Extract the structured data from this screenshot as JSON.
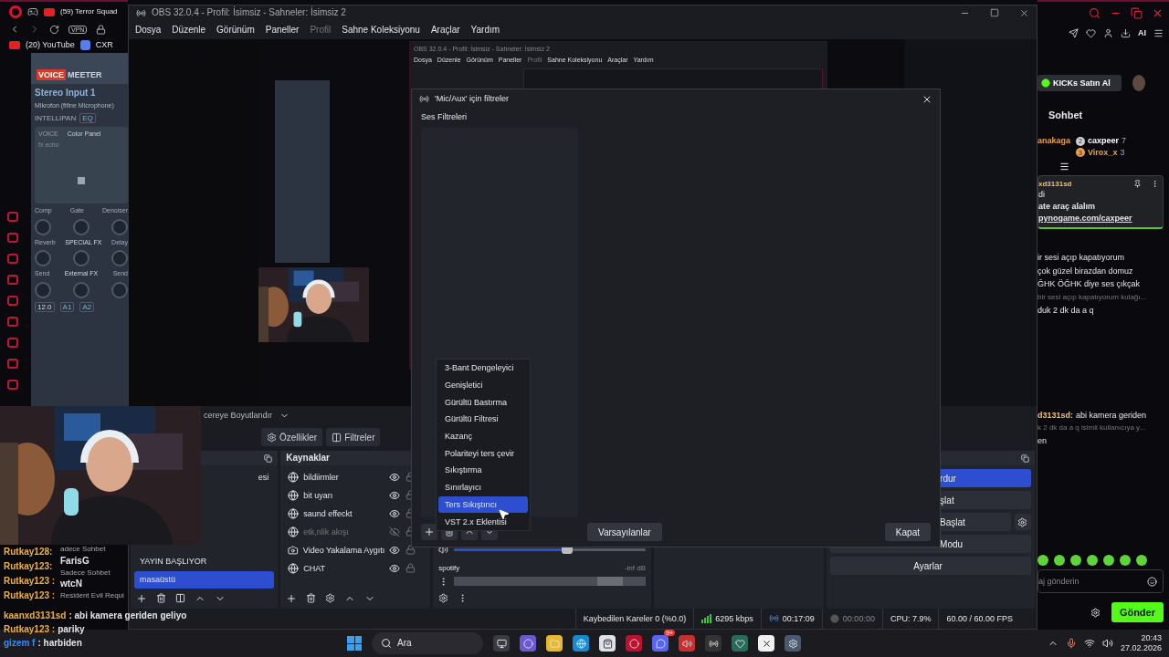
{
  "browser": {
    "tab": "(59) Terror Squad",
    "vpn": "VPN",
    "bookmarks": [
      "(20) YouTube",
      "CXR"
    ],
    "ai_button": "AI"
  },
  "voicemeeter": {
    "brand": [
      "VOICE",
      "MEETER"
    ],
    "strip_title": "Stereo Input 1",
    "strip_device": "Mikrofon (fifine Microphone)",
    "intellipan": "INTELLIPAN",
    "eq": "EQ",
    "voice": "VOICE",
    "color_panel": "Color Panel",
    "fx": "fx echo",
    "knob_rows": [
      [
        "Comp",
        "Gate",
        "Denoiser"
      ],
      [
        "Reverb",
        "SPECIAL FX",
        "Delay"
      ],
      [
        "Send",
        "External FX",
        "Send"
      ]
    ],
    "gain": "12.0",
    "buses": [
      "A1",
      "A2"
    ]
  },
  "obs": {
    "title": "OBS 32.0.4 - Profil: İsimsiz - Sahneler: İsimsiz 2",
    "menu": [
      {
        "label": "Dosya",
        "disabled": false
      },
      {
        "label": "Düzenle",
        "disabled": false
      },
      {
        "label": "Görünüm",
        "disabled": false
      },
      {
        "label": "Paneller",
        "disabled": false
      },
      {
        "label": "Profil",
        "disabled": true
      },
      {
        "label": "Sahne Koleksiyonu",
        "disabled": false
      },
      {
        "label": "Araçlar",
        "disabled": false
      },
      {
        "label": "Yardım",
        "disabled": false
      }
    ],
    "preview": {
      "title": "OBS 32.0.4 - Profil: İsimsiz - Sahneler: İsimsiz 2",
      "menu": [
        {
          "label": "Dosya",
          "disabled": false
        },
        {
          "label": "Düzenle",
          "disabled": false
        },
        {
          "label": "Görünüm",
          "disabled": false
        },
        {
          "label": "Paneller",
          "disabled": false
        },
        {
          "label": "Profil",
          "disabled": true
        },
        {
          "label": "Sahne Koleksiyonu",
          "disabled": false
        },
        {
          "label": "Araçlar",
          "disabled": false
        },
        {
          "label": "Yardım",
          "disabled": false
        }
      ]
    },
    "resize_dropdown": "cereye Boyutlandır",
    "toolbar": [
      {
        "kind": "gear",
        "label": "Özellikler"
      },
      {
        "kind": "filter",
        "label": "Filtreler"
      }
    ],
    "scenes": [
      {
        "label": "esi",
        "selected": false
      },
      {
        "label": "YAYIN BAŞLIYOR",
        "selected": false
      },
      {
        "label": "masaüstü",
        "selected": true
      }
    ],
    "sources": {
      "title": "Kaynaklar",
      "items": [
        {
          "kind": "browser",
          "label": "bildiirmler",
          "visible": true
        },
        {
          "kind": "browser",
          "label": "bit uyarı",
          "visible": true
        },
        {
          "kind": "browser",
          "label": "saund effeckt",
          "visible": true
        },
        {
          "kind": "browser",
          "label": "etk,nlik akışı",
          "visible": false
        },
        {
          "kind": "camera",
          "label": "Video Yakalama Aygıtı",
          "visible": true
        },
        {
          "kind": "browser",
          "label": "CHAT",
          "visible": true
        }
      ]
    },
    "mixer": {
      "level": 0.59,
      "channel": "spotify",
      "reading": "-inf dB"
    },
    "controls": [
      {
        "label": "rdur",
        "active": true
      },
      {
        "label": "şlat",
        "active": false
      },
      {
        "label": "Başlat",
        "active": false
      },
      {
        "label": "Modu",
        "active": false
      },
      {
        "label": "Ayarlar",
        "active": false
      }
    ],
    "status": {
      "dropped": "Kaybedilen Kareler 0 (%0.0)",
      "bitrate": "6295 kbps",
      "stream_time": "00:17:09",
      "record_time": "00:00:00",
      "cpu": "CPU: 7.9%",
      "fps": "60.00 / 60.00 FPS"
    }
  },
  "filters_dialog": {
    "title": "'Mic/Aux' için filtreler",
    "section": "Ses Filtreleri",
    "defaults_button": "Varsayılanlar",
    "close_button": "Kapat"
  },
  "filter_menu": [
    {
      "label": "3-Bant Dengeleyici",
      "selected": false
    },
    {
      "label": "Genişletici",
      "selected": false
    },
    {
      "label": "Gürültü Bastırma",
      "selected": false
    },
    {
      "label": "Gürültü Filtresi",
      "selected": false
    },
    {
      "label": "Kazanç",
      "selected": false
    },
    {
      "label": "Polariteyi ters çevir",
      "selected": false
    },
    {
      "label": "Sıkıştırma",
      "selected": false
    },
    {
      "label": "Sınırlayıcı",
      "selected": false
    },
    {
      "label": "Ters Sıkıştırıcı",
      "selected": true
    },
    {
      "label": "VST 2.x Eklentisi",
      "selected": false
    }
  ],
  "kick_chat": {
    "buy_button": "KICKs Satın Al",
    "title": "Sohbet",
    "leader_cut": "anakaga",
    "leaders": [
      {
        "rank": "2",
        "name": "caxpeer",
        "count": "7",
        "color": "#ffffff"
      },
      {
        "rank": "3",
        "name": "Virox_x",
        "count": "3",
        "color": "#e8a04c"
      }
    ],
    "pinned": {
      "user": "xd3131sd",
      "lines": [
        "di",
        "ate araç alalım"
      ],
      "link": "pynogame.com/caxpeer"
    },
    "messages": [
      {
        "kind": "text",
        "text": "ir sesi açıp kapatıyorum"
      },
      {
        "kind": "text",
        "text": "çok güzel birazdan domuz"
      },
      {
        "kind": "text",
        "text": "ĞHK ÖĞHK diye ses çıkçak"
      },
      {
        "kind": "reply",
        "text": "bir sesi açıp kapatıyorum kulağı..."
      },
      {
        "kind": "text",
        "text": "duk 2 dk da a q"
      }
    ],
    "later_messages": [
      {
        "kind": "user",
        "user": "d3131sd:",
        "text": "abi kamera geriden"
      },
      {
        "kind": "reply",
        "text": "k 2 dk da a q isimli kullanıcıya y..."
      },
      {
        "kind": "text",
        "text": "en"
      }
    ],
    "input_placeholder": "aj gönderin",
    "send": "Gönder"
  },
  "stream_chat": {
    "names": [
      "Rutkay128:",
      "Rutkay123:",
      "Rutkay123 :",
      "Rutkay123 :"
    ],
    "top_note": "adece Sohbet",
    "cards": [
      {
        "user": "FarisG",
        "text": "Sadece Sohbet"
      },
      {
        "user": "wtcN",
        "text": "Resident Evil Requi"
      }
    ],
    "lines": [
      {
        "user": "kaanxd3131sd",
        "text": ": abi kamera geriden geliyo"
      },
      {
        "user": "Rutkay123 :",
        "text": "pariky"
      },
      {
        "user": "gizem f",
        "text": ": harbiden"
      }
    ]
  },
  "taskbar": {
    "search": "Ara",
    "badge": "9+",
    "time": "20:43",
    "date": "27.02.2026"
  }
}
